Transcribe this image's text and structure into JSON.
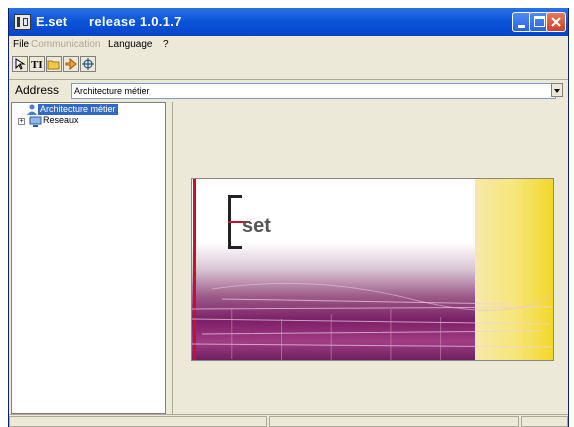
{
  "window": {
    "title": "E.set",
    "release": "release 1.0.1.7"
  },
  "menu": [
    {
      "label": "File"
    },
    {
      "label": "Communication"
    },
    {
      "label": "Language"
    },
    {
      "label": "?"
    }
  ],
  "toolbar": {
    "tools": [
      "open-icon",
      "text-tool-icon",
      "folder-icon",
      "export-icon",
      "settings-icon"
    ]
  },
  "address": {
    "label": "Address",
    "value": "Architecture métier"
  },
  "tree": {
    "items": [
      {
        "label": "Architecture métier",
        "icon": "user-group-icon",
        "selected": true
      },
      {
        "label": "Reseaux",
        "icon": "network-icon",
        "selected": false
      }
    ]
  },
  "banner": {
    "logo_text": "set",
    "colors": {
      "accent_red": "#c8102e",
      "yellow": "#f3d72a",
      "purple": "#7b1f67"
    }
  },
  "colors": {
    "titlebar": "#0a55da",
    "selection": "#316ac5",
    "face": "#ece9d8"
  }
}
